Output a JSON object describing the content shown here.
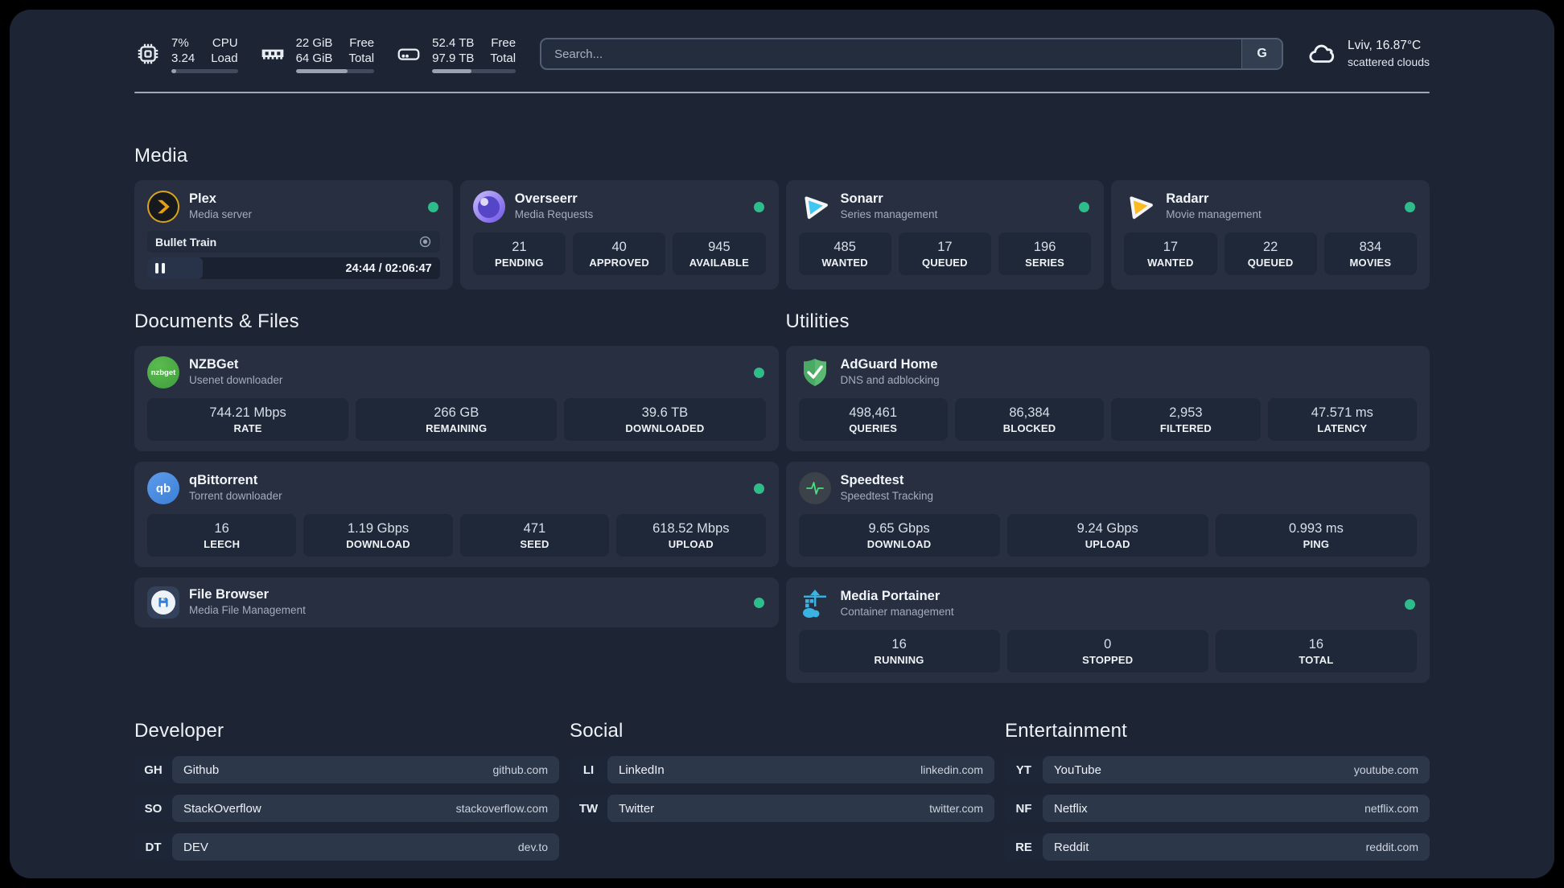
{
  "header": {
    "cpu": {
      "value_top": "7%",
      "value_bottom": "3.24",
      "label_top": "CPU",
      "label_bottom": "Load",
      "progress_pct": 7
    },
    "ram": {
      "value_top": "22 GiB",
      "value_bottom": "64 GiB",
      "label_top": "Free",
      "label_bottom": "Total",
      "progress_pct": 66
    },
    "disk": {
      "value_top": "52.4 TB",
      "value_bottom": "97.9 TB",
      "label_top": "Free",
      "label_bottom": "Total",
      "progress_pct": 47
    },
    "search": {
      "placeholder": "Search...",
      "button_label": "G"
    },
    "weather": {
      "summary": "Lviv, 16.87°C",
      "condition": "scattered clouds"
    }
  },
  "sections": {
    "media": "Media",
    "documents": "Documents & Files",
    "utilities": "Utilities",
    "developer": "Developer",
    "social": "Social",
    "entertainment": "Entertainment"
  },
  "cards": {
    "plex": {
      "name": "Plex",
      "desc": "Media server",
      "now_playing": "Bullet Train",
      "time": "24:44 / 02:06:47",
      "progress_pct": 19,
      "status": "online"
    },
    "overseerr": {
      "name": "Overseerr",
      "desc": "Media Requests",
      "status": "online",
      "stats": [
        {
          "value": "21",
          "label": "PENDING"
        },
        {
          "value": "40",
          "label": "APPROVED"
        },
        {
          "value": "945",
          "label": "AVAILABLE"
        }
      ]
    },
    "sonarr": {
      "name": "Sonarr",
      "desc": "Series management",
      "status": "online",
      "stats": [
        {
          "value": "485",
          "label": "WANTED"
        },
        {
          "value": "17",
          "label": "QUEUED"
        },
        {
          "value": "196",
          "label": "SERIES"
        }
      ]
    },
    "radarr": {
      "name": "Radarr",
      "desc": "Movie management",
      "status": "online",
      "stats": [
        {
          "value": "17",
          "label": "WANTED"
        },
        {
          "value": "22",
          "label": "QUEUED"
        },
        {
          "value": "834",
          "label": "MOVIES"
        }
      ]
    },
    "nzbget": {
      "name": "NZBGet",
      "desc": "Usenet downloader",
      "icon_text": "nzbget",
      "status": "online",
      "stats": [
        {
          "value": "744.21 Mbps",
          "label": "RATE"
        },
        {
          "value": "266 GB",
          "label": "REMAINING"
        },
        {
          "value": "39.6 TB",
          "label": "DOWNLOADED"
        }
      ]
    },
    "qbittorrent": {
      "name": "qBittorrent",
      "desc": "Torrent downloader",
      "icon_text": "qb",
      "status": "online",
      "stats": [
        {
          "value": "16",
          "label": "LEECH"
        },
        {
          "value": "1.19 Gbps",
          "label": "DOWNLOAD"
        },
        {
          "value": "471",
          "label": "SEED"
        },
        {
          "value": "618.52 Mbps",
          "label": "UPLOAD"
        }
      ]
    },
    "filebrowser": {
      "name": "File Browser",
      "desc": "Media File Management",
      "status": "online"
    },
    "adguard": {
      "name": "AdGuard Home",
      "desc": "DNS and adblocking",
      "stats": [
        {
          "value": "498,461",
          "label": "QUERIES"
        },
        {
          "value": "86,384",
          "label": "BLOCKED"
        },
        {
          "value": "2,953",
          "label": "FILTERED"
        },
        {
          "value": "47.571 ms",
          "label": "LATENCY"
        }
      ]
    },
    "speedtest": {
      "name": "Speedtest",
      "desc": "Speedtest Tracking",
      "stats": [
        {
          "value": "9.65 Gbps",
          "label": "DOWNLOAD"
        },
        {
          "value": "9.24 Gbps",
          "label": "UPLOAD"
        },
        {
          "value": "0.993 ms",
          "label": "PING"
        }
      ]
    },
    "portainer": {
      "name": "Media Portainer",
      "desc": "Container management",
      "status": "online",
      "stats": [
        {
          "value": "16",
          "label": "RUNNING"
        },
        {
          "value": "0",
          "label": "STOPPED"
        },
        {
          "value": "16",
          "label": "TOTAL"
        }
      ]
    }
  },
  "links": {
    "developer": [
      {
        "abbr": "GH",
        "name": "Github",
        "domain": "github.com"
      },
      {
        "abbr": "SO",
        "name": "StackOverflow",
        "domain": "stackoverflow.com"
      },
      {
        "abbr": "DT",
        "name": "DEV",
        "domain": "dev.to"
      }
    ],
    "social": [
      {
        "abbr": "LI",
        "name": "LinkedIn",
        "domain": "linkedin.com"
      },
      {
        "abbr": "TW",
        "name": "Twitter",
        "domain": "twitter.com"
      }
    ],
    "entertainment": [
      {
        "abbr": "YT",
        "name": "YouTube",
        "domain": "youtube.com"
      },
      {
        "abbr": "NF",
        "name": "Netflix",
        "domain": "netflix.com"
      },
      {
        "abbr": "RE",
        "name": "Reddit",
        "domain": "reddit.com"
      }
    ]
  },
  "colors": {
    "status_online": "#2dbd8a",
    "accent_plex": "#e5a00d",
    "accent_sonarr": "#41c6f2",
    "accent_radarr": "#ffb921",
    "accent_portainer": "#38b3e3"
  }
}
